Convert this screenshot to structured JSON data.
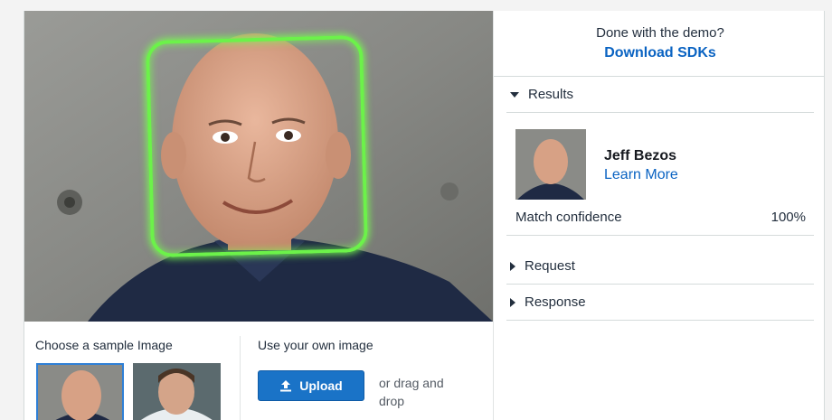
{
  "demo": {
    "sample_label": "Choose a sample Image",
    "own_label": "Use your own image",
    "upload_label": "Upload",
    "drag_text": "or drag and drop"
  },
  "panel": {
    "done_text": "Done with the demo?",
    "sdk_link": "Download SDKs",
    "sections": {
      "results": "Results",
      "request": "Request",
      "response": "Response"
    },
    "result": {
      "name": "Jeff Bezos",
      "learn_more": "Learn More",
      "confidence_label": "Match confidence",
      "confidence_value": "100%"
    }
  },
  "colors": {
    "accent": "#1a73c7",
    "link": "#0a63c2",
    "face_box": "#6cf24a"
  }
}
